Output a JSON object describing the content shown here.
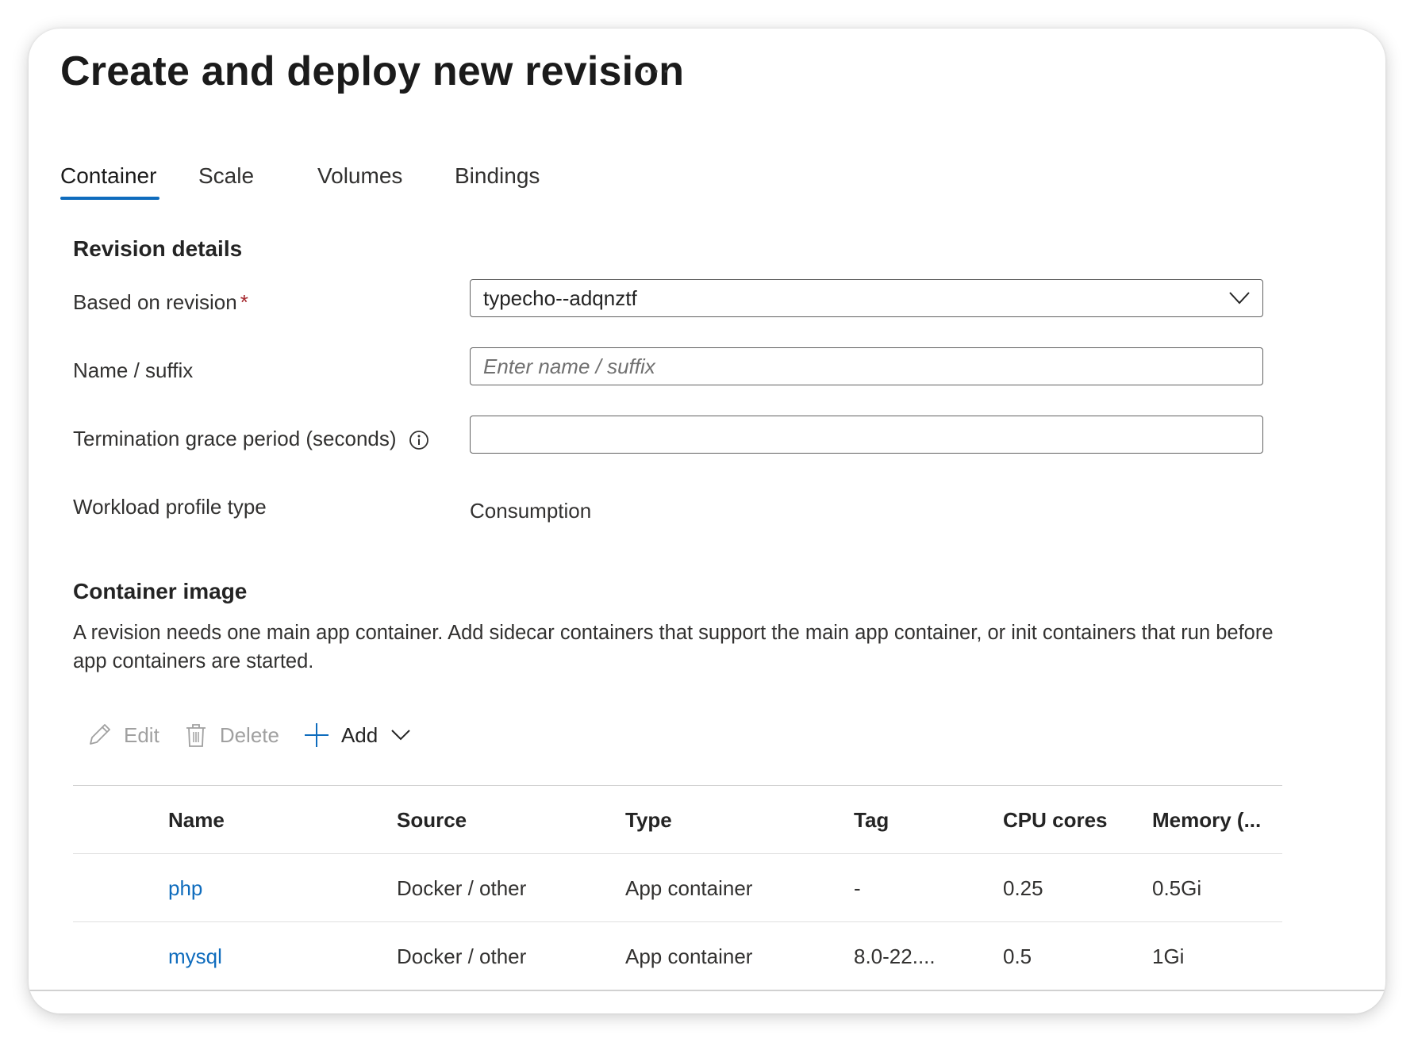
{
  "page": {
    "title": "Create and deploy new revision",
    "more_label": "···"
  },
  "tabs": [
    {
      "label": "Container",
      "active": true
    },
    {
      "label": "Scale",
      "active": false
    },
    {
      "label": "Volumes",
      "active": false
    },
    {
      "label": "Bindings",
      "active": false
    }
  ],
  "revision_details": {
    "heading": "Revision details",
    "based_on_revision": {
      "label": "Based on revision",
      "required_mark": "*",
      "value": "typecho--adqnztf"
    },
    "name_suffix": {
      "label": "Name / suffix",
      "value": "",
      "placeholder": "Enter name / suffix"
    },
    "termination_grace": {
      "label": "Termination grace period (seconds)",
      "value": ""
    },
    "workload_profile": {
      "label": "Workload profile type",
      "value": "Consumption"
    }
  },
  "container_image": {
    "heading": "Container image",
    "description": "A revision needs one main app container. Add sidecar containers that support the main app container, or init containers that run before app containers are started."
  },
  "toolbar": {
    "edit_label": "Edit",
    "delete_label": "Delete",
    "add_label": "Add"
  },
  "table": {
    "headers": [
      "Name",
      "Source",
      "Type",
      "Tag",
      "CPU cores",
      "Memory (..."
    ],
    "rows": [
      [
        "php",
        "Docker / other",
        "App container",
        "-",
        "0.25",
        "0.5Gi"
      ],
      [
        "mysql",
        "Docker / other",
        "App container",
        "8.0-22....",
        "0.5",
        "1Gi"
      ]
    ]
  },
  "colors": {
    "accent": "#0f6cbd",
    "required": "#a4262c",
    "text": "#242424",
    "disabled": "#a0a0a0"
  }
}
